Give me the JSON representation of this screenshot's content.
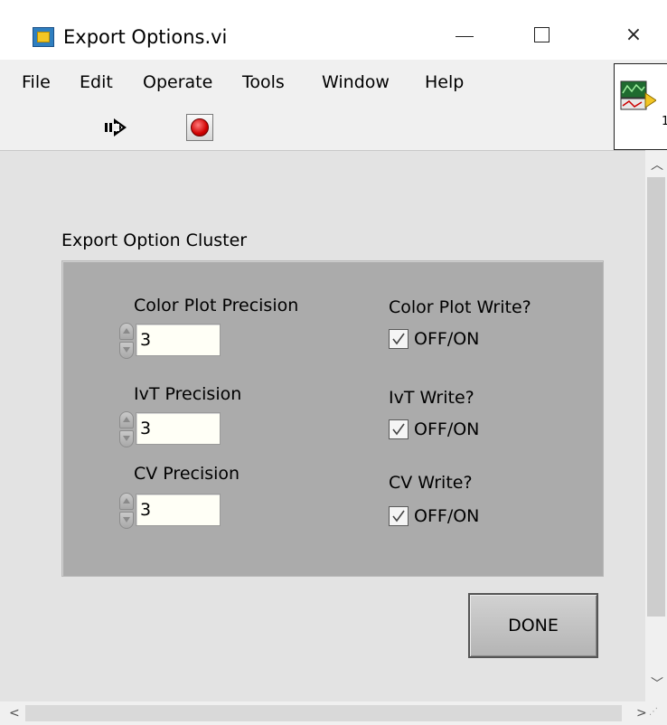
{
  "window": {
    "title": "Export Options.vi",
    "controls": {
      "minimize": "—",
      "maximize": "☐",
      "close": "×"
    }
  },
  "menu": {
    "items": [
      "File",
      "Edit",
      "Operate",
      "Tools",
      "Window",
      "Help"
    ]
  },
  "toolbar": {
    "run_icon": "run-arrow-icon",
    "abort_icon": "abort-stop-icon"
  },
  "vi_icon": {
    "number": "1"
  },
  "cluster": {
    "label": "Export Option Cluster",
    "numerics": [
      {
        "label": "Color Plot Precision",
        "value": "3"
      },
      {
        "label": "IvT Precision",
        "value": "3"
      },
      {
        "label": "CV Precision",
        "value": "3"
      }
    ],
    "booleans": [
      {
        "label": "Color Plot Write?",
        "text": "OFF/ON",
        "checked": true
      },
      {
        "label": "IvT Write?",
        "text": "OFF/ON",
        "checked": true
      },
      {
        "label": "CV Write?",
        "text": "OFF/ON",
        "checked": true
      }
    ]
  },
  "done_button": {
    "label": "DONE"
  },
  "colors": {
    "panel": "#e3e3e3",
    "cluster": "#ababab",
    "field": "#fffff6",
    "stop": "#d00000"
  }
}
